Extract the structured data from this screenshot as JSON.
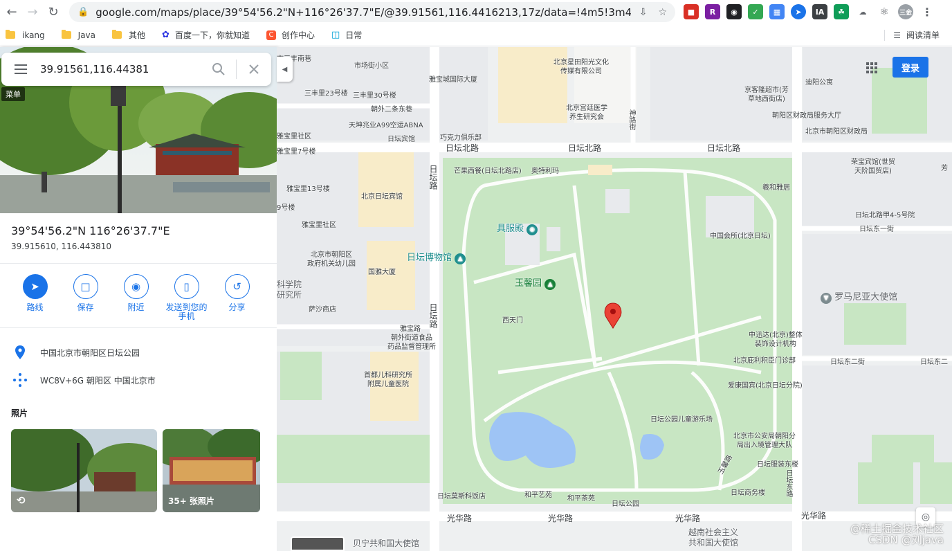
{
  "browser": {
    "url": "google.com/maps/place/39°54'56.2\"N+116°26'37.7\"E/@39.91561,116.4416213,17z/data=!4m5!3m4!1s0x0:0x0!8...",
    "bookmarks": [
      "ikang",
      "Java",
      "其他",
      "百度一下，你就知道",
      "创作中心",
      "日常"
    ],
    "reading_list": "阅读清单"
  },
  "panel": {
    "search_value": "39.91561,116.44381",
    "menu_tag": "菜单",
    "coords_dms": "39°54'56.2\"N 116°26'37.7\"E",
    "coords_decimal": "39.915610, 116.443810",
    "actions": [
      {
        "label": "路线"
      },
      {
        "label": "保存"
      },
      {
        "label": "附近"
      },
      {
        "label": "发送到您的手机"
      },
      {
        "label": "分享"
      }
    ],
    "address": "中国北京市朝阳区日坛公园",
    "plus_code": "WC8V+6G 朝阳区 中国北京市",
    "photos_header": "照片",
    "photo_count": "35+ 张照片"
  },
  "map": {
    "login": "登录",
    "watermark_line1": "@稀土掘金技术社区",
    "watermark_line2": "CSDN @刘java",
    "roads": {
      "ritan_north_1": "日坛北路",
      "ritan_north_2": "日坛北路",
      "ritan_north_3": "日坛北路",
      "ritan_road_1": "日坛路",
      "ritan_road_2": "日坛路",
      "guanghua_1": "光华路",
      "guanghua_2": "光华路",
      "guanghua_3": "光华路",
      "guanghua_4": "光华路",
      "yabao": "雅宝路",
      "chaowai_2": "朝外二条东巷",
      "ritan_east_2": "日坛东二街",
      "ritan_east_2b": "日坛东二",
      "ritan_north_1st": "日坛东一街",
      "ritan_east_road": "日坛东路",
      "shenlu": "神路街",
      "yuxin": "玉馨路"
    },
    "pois": {
      "juzhaodian": "具服殿",
      "museum": "日坛博物馆",
      "yuxinyuan": "玉馨园",
      "romania": "罗马尼亚大使馆",
      "beijing_academy": "科学院\n研究所",
      "vietnam": "越南社会主义\n共和国大使馆",
      "benin": "贝宁共和国大使馆"
    },
    "labels": {
      "a1": "市三丰南巷",
      "a2": "市场街小区",
      "a3": "雅宝城国际大厦",
      "a4": "北京星田阳光文化\n传媒有限公司",
      "a5": "迪阳公寓",
      "a6": "京客隆超市(芳\n草地西街店)",
      "a7": "北京宫廷医学\n养生研究会",
      "a8": "朝阳区财政局服务大厅",
      "a9": "北京市朝阳区财政局",
      "a10": "三丰里23号楼",
      "a11": "三丰里30号楼",
      "a12": "天坤兆业A99空运ABNA",
      "a13": "雅宝里社区",
      "a14": "日坛宾馆",
      "a15": "巧克力俱乐部",
      "a16": "雅宝里7号楼",
      "a17": "芒果西餐(日坛北路店)",
      "a18": "奥特利玛",
      "a19": "荣宝宾馆(世贸\n天阶国贸店)",
      "a20": "雅宝里13号楼",
      "a21": "北京日坛宾馆",
      "a22": "羲和雅居",
      "a23": "9号楼",
      "a24": "日坛北路甲4-5号院",
      "a25": "雅宝里社区",
      "a26": "中国会所(北京日坛)",
      "a27": "北京市朝阳区\n政府机关幼儿园",
      "a28": "国雅大厦",
      "a29": "萨沙商店",
      "a30": "西天门",
      "a31": "中迅达(北京)整体\n装饰设计机构",
      "a32": "朝外街道食品\n药品监督管理所",
      "a33": "北京庇利积臣门诊部",
      "a34": "首都儿科研究所\n附属儿童医院",
      "a35": "爱康国宾(北京日坛分院)",
      "a36": "日坛公园儿童游乐场",
      "a37": "北京市公安局朝阳分\n局出入境管理大队",
      "a38": "日坛服装东楼",
      "a39": "日坛莫斯科饭店",
      "a40": "和平艺苑",
      "a41": "和平茶苑",
      "a42": "日坛公园",
      "a43": "日坛商务楼",
      "a44": "芳"
    }
  },
  "colors": {
    "accent": "#1a73e8",
    "park": "#c8e6c3",
    "water": "#9ec4f5",
    "building": "#f8ecc9",
    "pin": "#ea4335"
  }
}
